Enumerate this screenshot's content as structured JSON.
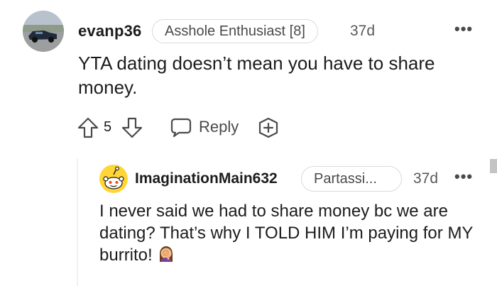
{
  "comment": {
    "author": "evanp36",
    "flair": "Asshole Enthusiast [8]",
    "time": "37d",
    "more": "•••",
    "body": "YTA dating doesn’t mean you have to share money.",
    "votes": "5",
    "reply_label": "Reply",
    "avatar_icon": "car-photo-avatar",
    "upvote_icon": "upvote-arrow-icon",
    "downvote_icon": "downvote-arrow-icon",
    "reply_icon": "speech-bubble-icon",
    "award_icon": "award-plus-icon"
  },
  "reply": {
    "author": "ImaginationMain632",
    "flair": "Partassi...",
    "time": "37d",
    "more": "•••",
    "body": "I never said we had to share money bc we are dating? That’s why I TOLD HIM I’m paying for MY burrito!",
    "avatar_icon": "snoo-avatar",
    "emoji_icon": "facepalm-emoji"
  },
  "colors": {
    "text": "#1c1c1c",
    "meta": "#55595c",
    "border": "#d7dadc",
    "snoo_yellow": "#ffd635"
  }
}
